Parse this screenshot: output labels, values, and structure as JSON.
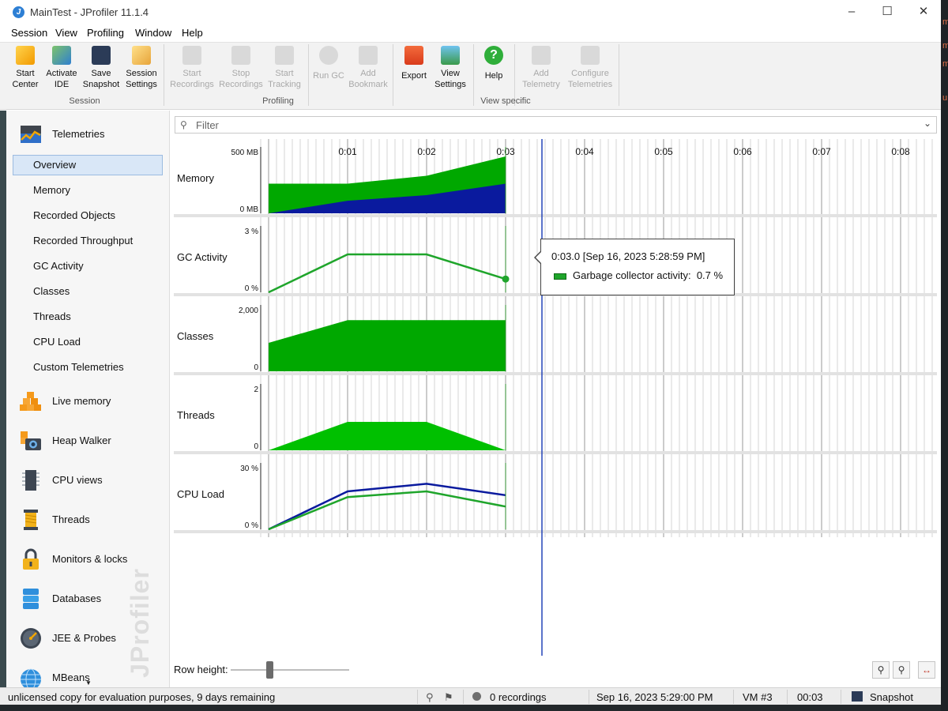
{
  "window": {
    "title": "MainTest - JProfiler 11.1.4",
    "app_icon": "jprofiler-logo-icon",
    "controls": [
      "minimize",
      "maximize",
      "close"
    ]
  },
  "menu": [
    "Session",
    "View",
    "Profiling",
    "Window",
    "Help"
  ],
  "toolbar": {
    "groups": [
      {
        "label": "Session",
        "buttons": [
          {
            "label": "Start\nCenter",
            "icon": "start-center-icon",
            "enabled": true
          },
          {
            "label": "Activate\nIDE",
            "icon": "activate-ide-icon",
            "enabled": true
          },
          {
            "label": "Save\nSnapshot",
            "icon": "save-snapshot-icon",
            "enabled": true
          },
          {
            "label": "Session\nSettings",
            "icon": "session-settings-icon",
            "enabled": true
          }
        ]
      },
      {
        "label": "Profiling",
        "buttons": [
          {
            "label": "Start\nRecordings",
            "icon": "start-recordings-icon",
            "enabled": false
          },
          {
            "label": "Stop\nRecordings",
            "icon": "stop-recordings-icon",
            "enabled": false
          },
          {
            "label": "Start\nTracking",
            "icon": "start-tracking-icon",
            "enabled": false
          },
          {
            "label": "Run GC",
            "icon": "run-gc-icon",
            "enabled": false
          },
          {
            "label": "Add\nBookmark",
            "icon": "add-bookmark-icon",
            "enabled": false
          }
        ]
      },
      {
        "label": "View specific",
        "buttons": [
          {
            "label": "Export",
            "icon": "export-icon",
            "enabled": true
          },
          {
            "label": "View\nSettings",
            "icon": "view-settings-icon",
            "enabled": true
          },
          {
            "label": "Help",
            "icon": "help-icon",
            "enabled": true
          },
          {
            "label": "Add\nTelemetry",
            "icon": "add-telemetry-icon",
            "enabled": false
          },
          {
            "label": "Configure\nTelemetries",
            "icon": "configure-telemetries-icon",
            "enabled": false
          }
        ]
      }
    ]
  },
  "sidebar": {
    "telemetries_label": "Telemetries",
    "telemetry_items": [
      "Overview",
      "Memory",
      "Recorded Objects",
      "Recorded Throughput",
      "GC Activity",
      "Classes",
      "Threads",
      "CPU Load",
      "Custom Telemetries"
    ],
    "selected_item": "Overview",
    "sections": [
      {
        "label": "Live memory",
        "icon": "live-memory-icon"
      },
      {
        "label": "Heap Walker",
        "icon": "heap-walker-icon"
      },
      {
        "label": "CPU views",
        "icon": "cpu-views-icon"
      },
      {
        "label": "Threads",
        "icon": "threads-icon"
      },
      {
        "label": "Monitors & locks",
        "icon": "monitors-locks-icon"
      },
      {
        "label": "Databases",
        "icon": "databases-icon"
      },
      {
        "label": "JEE & Probes",
        "icon": "jee-probes-icon"
      },
      {
        "label": "MBeans",
        "icon": "mbeans-icon"
      }
    ],
    "watermark": "JProfiler"
  },
  "filter": {
    "placeholder": "Filter"
  },
  "timeline": {
    "ticks": [
      "0:01",
      "0:02",
      "0:03",
      "0:04",
      "0:05",
      "0:06",
      "0:07",
      "0:08"
    ],
    "current_time_marker": "0:03.5"
  },
  "chart_data": [
    {
      "type": "area",
      "title": "Memory",
      "x": [
        "0:00",
        "0:01",
        "0:02",
        "0:03"
      ],
      "ylim": [
        0,
        500
      ],
      "y_tick_labels": [
        "500 MB",
        "0 MB"
      ],
      "series": [
        {
          "values": [
            260,
            260,
            330,
            500
          ],
          "color": "#00a800"
        },
        {
          "values": [
            0,
            110,
            160,
            260
          ],
          "color": "#0a1a9e"
        }
      ]
    },
    {
      "type": "line",
      "title": "GC Activity",
      "x": [
        "0:00",
        "0:01",
        "0:02",
        "0:03"
      ],
      "ylim": [
        0,
        3
      ],
      "y_tick_labels": [
        "3 %",
        "0 %"
      ],
      "series": [
        {
          "values": [
            0,
            2.0,
            2.0,
            0.7
          ],
          "color": "#1fa52b"
        }
      ]
    },
    {
      "type": "area",
      "title": "Classes",
      "x": [
        "0:00",
        "0:01",
        "0:02",
        "0:03"
      ],
      "ylim": [
        0,
        2000
      ],
      "y_tick_labels": [
        "2,000",
        "0"
      ],
      "series": [
        {
          "values": [
            1000,
            1800,
            1800,
            1800
          ],
          "color": "#00a800"
        }
      ]
    },
    {
      "type": "area",
      "title": "Threads",
      "x": [
        "0:00",
        "0:01",
        "0:02",
        "0:03"
      ],
      "ylim": [
        0,
        2
      ],
      "y_tick_labels": [
        "2",
        "0"
      ],
      "series": [
        {
          "values": [
            0,
            1,
            1,
            0
          ],
          "color": "#00c000"
        }
      ]
    },
    {
      "type": "line",
      "title": "CPU Load",
      "x": [
        "0:00",
        "0:01",
        "0:02",
        "0:03"
      ],
      "ylim": [
        0,
        30
      ],
      "y_tick_labels": [
        "30 %",
        "0 %"
      ],
      "series": [
        {
          "values": [
            0,
            20,
            24,
            18
          ],
          "color": "#0a1a9e"
        },
        {
          "values": [
            0,
            17,
            20,
            12
          ],
          "color": "#1fa52b"
        }
      ]
    }
  ],
  "tooltip": {
    "title": "0:03.0 [Sep 16, 2023 5:28:59 PM]",
    "row_label": "Garbage collector activity:",
    "row_value": "0.7 %",
    "swatch_color": "#1fa52b"
  },
  "row_height": {
    "label": "Row height:"
  },
  "zoom_buttons": [
    "zoom-in-icon",
    "zoom-out-icon",
    "fit-icon"
  ],
  "statusbar": {
    "license": "unlicensed copy for evaluation purposes, 9 days remaining",
    "recordings": "0 recordings",
    "datetime": "Sep 16, 2023 5:29:00 PM",
    "vm": "VM #3",
    "elapsed": "00:03",
    "mode": "Snapshot"
  }
}
